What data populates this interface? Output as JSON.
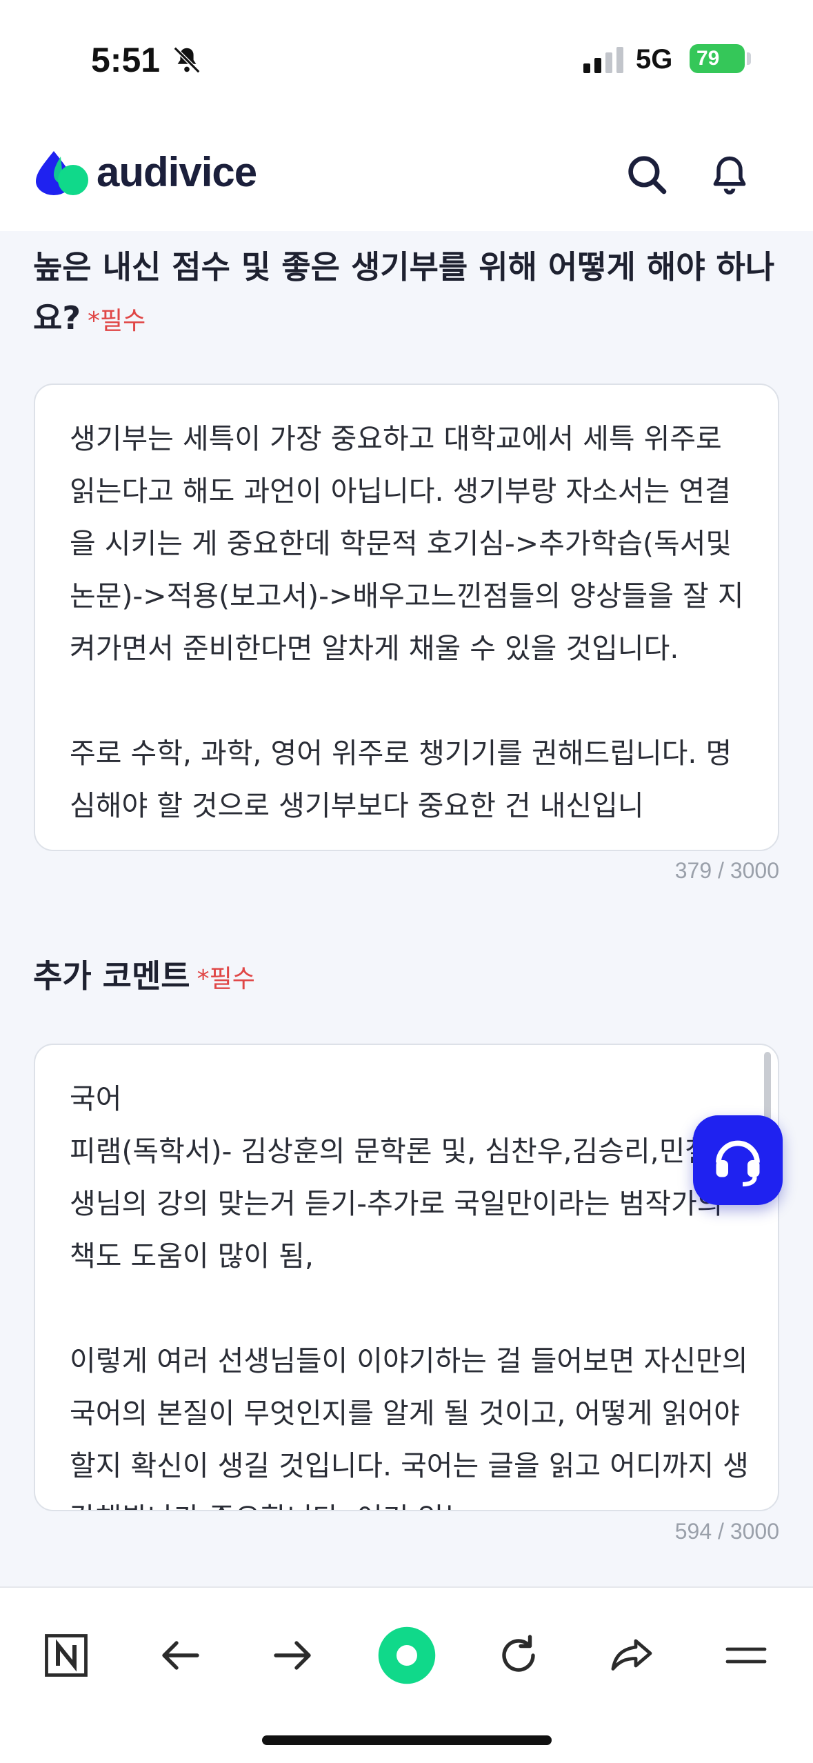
{
  "status": {
    "time": "5:51",
    "network": "5G",
    "battery": "79"
  },
  "app": {
    "logo_text": "audivice",
    "accent": "#1f22f0",
    "brand_green": "#10d98a"
  },
  "question1": {
    "title": "높은 내신 점수 및 좋은 생기부를 위해 어떻게 해야 하나요?",
    "required": "*필수",
    "answer": "생기부는 세특이 가장 중요하고 대학교에서 세특 위주로 읽는다고 해도 과언이 아닙니다. 생기부랑 자소서는 연결을 시키는 게 중요한데 학문적 호기심->추가학습(독서및논문)->적용(보고서)->배우고느낀점들의 양상들을 잘 지켜가면서 준비한다면 알차게 채울 수 있을 것입니다.\n\n주로 수학, 과학, 영어 위주로 챙기기를 권해드립니다. 명심해야 할 것으로 생기부보다 중요한 건 내신입니",
    "counter": "379 / 3000"
  },
  "question2": {
    "title": "추가 코멘트",
    "required": "*필수",
    "answer": "국어\n피램(독학서)- 김상훈의 문학론 및, 심찬우,김승리,민철 선생님의 강의 맞는거 듣기-추가로 국일만이라는 범작가의 책도 도움이 많이 됨,\n\n이렇게 여러 선생님들이 이야기하는 걸 들어보면 자신만의 국어의 본질이 무엇인지를 알게 될 것이고, 어떻게 읽어야 할지 확신이 생길 것입니다. 국어는 글을 읽고 어디까지 생각해봤냐가 중요합니다. 여기 있는",
    "counter": "594 / 3000"
  },
  "icons": {
    "search": "search-icon",
    "notifications": "bell-icon",
    "help": "headset-icon",
    "naver": "n-icon",
    "back": "arrow-left-icon",
    "forward": "arrow-right-icon",
    "home": "green-dot-icon",
    "reload": "reload-icon",
    "share": "share-icon",
    "menu": "menu-icon"
  }
}
